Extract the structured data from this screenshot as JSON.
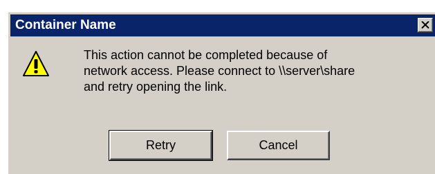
{
  "dialog": {
    "title": "Container Name",
    "close_icon": "close-icon",
    "icon": "warning-icon",
    "message_lines": [
      "This action cannot be completed because of",
      "network access. Please connect to \\\\server\\share",
      "and retry opening the link."
    ],
    "buttons": {
      "retry_label": "Retry",
      "cancel_label": "Cancel"
    }
  },
  "colors": {
    "titlebar": "#0a246a",
    "face": "#d4d0c8",
    "warning_fill": "#ffff00"
  }
}
